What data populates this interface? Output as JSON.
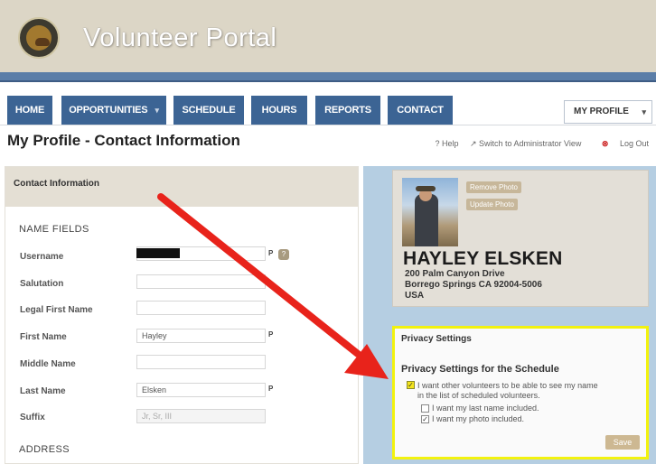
{
  "header": {
    "brand": "Volunteer Portal",
    "logo_icon": "california-state-parks-seal"
  },
  "nav": {
    "items": [
      {
        "label": "HOME",
        "has_caret": false
      },
      {
        "label": "OPPORTUNITIES",
        "has_caret": true
      },
      {
        "label": "SCHEDULE",
        "has_caret": false
      },
      {
        "label": "HOURS",
        "has_caret": false
      },
      {
        "label": "REPORTS",
        "has_caret": false
      },
      {
        "label": "CONTACT",
        "has_caret": false
      }
    ],
    "caret": "▾",
    "profile_dropdown": "MY PROFILE"
  },
  "page": {
    "title": "My Profile - Contact Information",
    "links": {
      "help": "? Help",
      "switch_admin": "↗ Switch to Administrator View",
      "logout": "Log Out",
      "logout_mark": "⊗"
    }
  },
  "contact": {
    "panel_title": "Contact Information",
    "name_section": "NAME FIELDS",
    "address_section": "ADDRESS",
    "fields": [
      {
        "label": "Username",
        "value": "",
        "redacted": true,
        "required": true,
        "help": true
      },
      {
        "label": "Salutation",
        "value": ""
      },
      {
        "label": "Legal First Name",
        "value": ""
      },
      {
        "label": "First Name",
        "value": "Hayley",
        "required": true
      },
      {
        "label": "Middle Name",
        "value": ""
      },
      {
        "label": "Last Name",
        "value": "Elsken",
        "required": true
      },
      {
        "label": "Suffix",
        "value": "Jr, Sr, III",
        "placeholder": true
      }
    ],
    "required_mark": "P",
    "help_glyph": "?"
  },
  "profile": {
    "remove_photo": "Remove Photo",
    "update_photo": "Update Photo",
    "name": "HAYLEY ELSKEN",
    "address_lines": [
      "200 Palm Canyon Drive",
      "Borrego Springs CA 92004-5006",
      "USA"
    ]
  },
  "privacy": {
    "title": "Privacy Settings",
    "subtitle": "Privacy Settings for the Schedule",
    "option_main": {
      "label_line1": "I want other volunteers to be able to see my name",
      "label_line2": "in the list of scheduled volunteers.",
      "checked": true
    },
    "option_last_name": {
      "label": "I want my last name included.",
      "checked": false
    },
    "option_photo": {
      "label": "I want my photo included.",
      "checked": true
    },
    "save": "Save",
    "highlight_color": "#f2f20e"
  },
  "annotation": {
    "arrow_color": "#e8231b"
  },
  "colors": {
    "nav_blue": "#3c6494",
    "header_tan": "#dcd6c6",
    "right_bg": "#b5cee2"
  }
}
